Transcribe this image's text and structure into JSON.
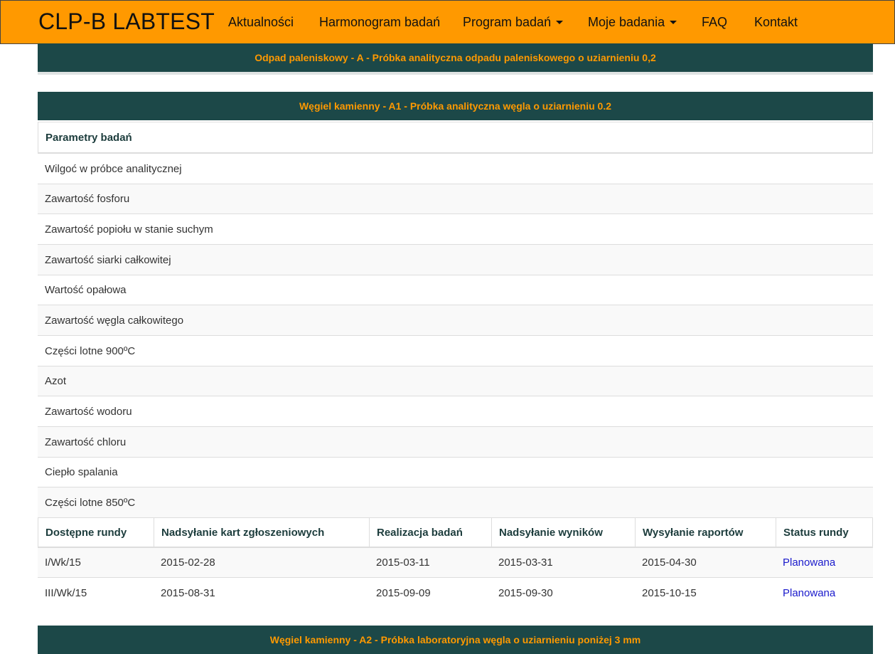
{
  "navbar": {
    "brand": "CLP-B LABTEST",
    "items": [
      {
        "label": "Aktualności",
        "dropdown": false
      },
      {
        "label": "Harmonogram badań",
        "dropdown": false
      },
      {
        "label": "Program badań",
        "dropdown": true
      },
      {
        "label": "Moje badania",
        "dropdown": true
      },
      {
        "label": "FAQ",
        "dropdown": false
      },
      {
        "label": "Kontakt",
        "dropdown": false
      }
    ]
  },
  "panels": [
    {
      "title": "Odpad paleniskowy - A - Próbka analityczna odpadu paleniskowego o uziarnieniu 0,2"
    },
    {
      "title": "Węgiel kamienny - A1 - Próbka analityczna węgla o uziarnieniu 0.2",
      "params_header": "Parametry badań",
      "params": [
        "Wilgoć w próbce analitycznej",
        "Zawartość fosforu",
        "Zawartość popiołu w stanie suchym",
        "Zawartość siarki całkowitej",
        "Wartość opałowa",
        "Zawartość węgla całkowitego",
        "Części lotne 900ºC",
        "Azot",
        "Zawartość wodoru",
        "Zawartość chloru",
        "Ciepło spalania",
        "Części lotne 850ºC"
      ],
      "rounds_headers": [
        "Dostępne rundy",
        "Nadsyłanie kart zgłoszeniowych",
        "Realizacja badań",
        "Nadsyłanie wyników",
        "Wysyłanie raportów",
        "Status rundy"
      ],
      "rounds": [
        [
          "I/Wk/15",
          "2015-02-28",
          "2015-03-11",
          "2015-03-31",
          "2015-04-30",
          "Planowana"
        ],
        [
          "III/Wk/15",
          "2015-08-31",
          "2015-09-09",
          "2015-09-30",
          "2015-10-15",
          "Planowana"
        ]
      ]
    },
    {
      "title": "Węgiel kamienny - A2 - Próbka laboratoryjna węgla o uziarnieniu poniżej 3 mm"
    }
  ],
  "colors": {
    "navbar_bg": "#ff9900",
    "panel_head_bg": "#1c4848",
    "panel_head_text": "#ff9900",
    "status_link": "#1a1acc"
  }
}
